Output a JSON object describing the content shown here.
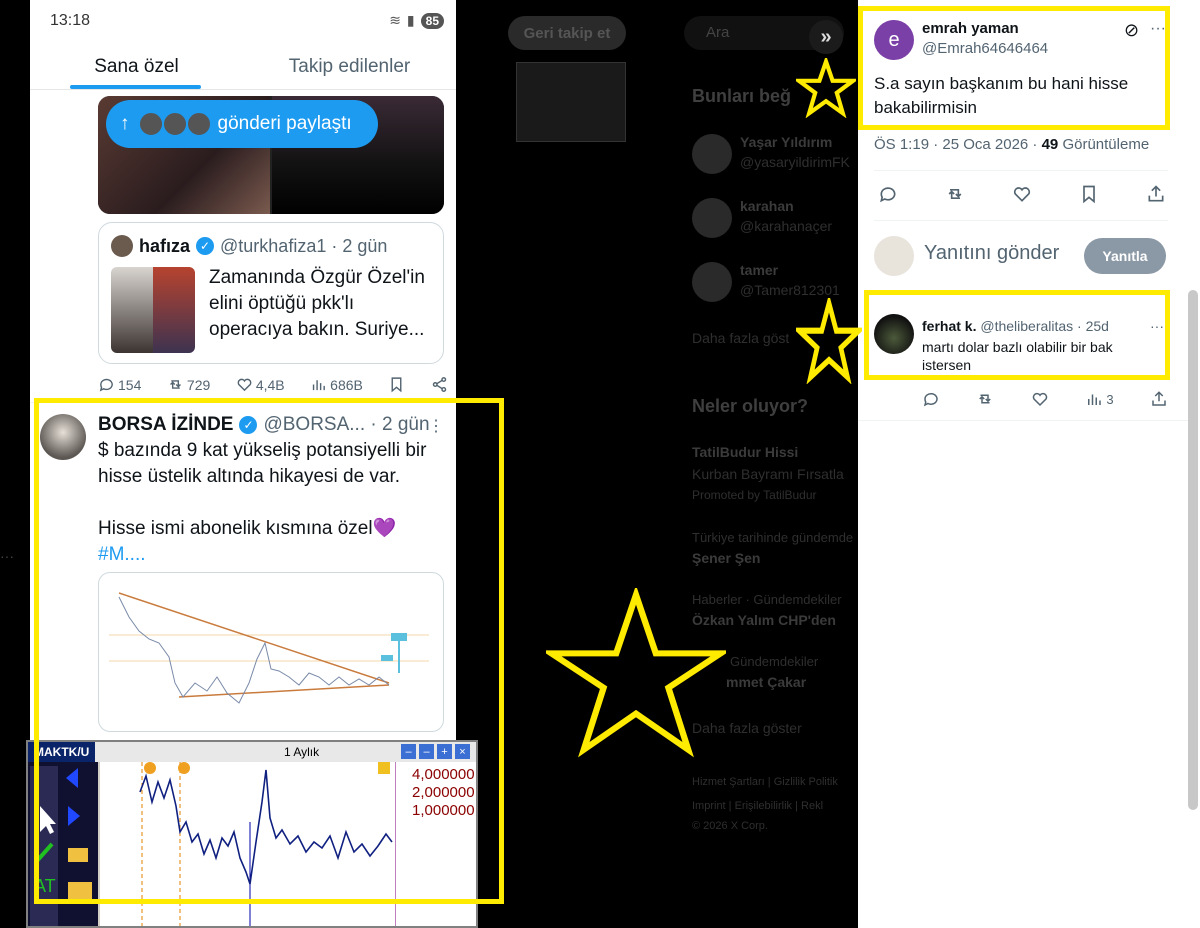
{
  "phone": {
    "time": "13:18",
    "battery": "85",
    "tabs": [
      "Sana özel",
      "Takip edilenler"
    ],
    "share_pill": "gönderi paylaştı",
    "quote": {
      "name": "hafıza",
      "handle": "@turkhafiza1 · 2 gün",
      "text": "Zamanında Özgür Özel'in elini öptüğü pkk'lı operacıya bakın. Suriye..."
    },
    "actions": {
      "replies": "154",
      "reposts": "729",
      "likes": "4,4B",
      "views": "686B"
    },
    "tweet": {
      "name": "BORSA İZİNDE",
      "handle": "@BORSA... · 2 gün",
      "line1": "$ bazında 9 kat yükseliş potansiyelli bir hisse üstelik altında hikayesi de var.",
      "line2": "Hisse ismi abonelik kısmına özel💜",
      "hashtag": "#M...."
    },
    "inset": {
      "ticker": "MAKTK/U",
      "period": "1 Aylık",
      "axis": [
        "4,000000",
        "2,000000",
        "1,000000"
      ]
    }
  },
  "background": {
    "follow_btn": "Geri takip et",
    "search": "Ara",
    "who_to_follow": "Bunları beğ",
    "follow_names": [
      "Yaşar Yıldırım",
      "karahan",
      "tamer"
    ],
    "follow_handles": [
      "@yasaryildirimFK",
      "@karahanaçer",
      "@Tamer812301"
    ],
    "show_more": "Daha fazla göst",
    "whats_happening": "Neler oluyor?",
    "trend1_title": "TatilBudur Hissi",
    "trend1_sub": "Kurban Bayramı Fırsatla",
    "trend1_promo": "Promoted by TatilBudur",
    "trend2_ctx": "Türkiye tarihinde gündemde",
    "trend2_title": "Şener Şen",
    "trend3_ctx": "Haberler · Gündemdekiler",
    "trend3_title": "Özkan Yalım CHP'den",
    "trend4_ctx": "Gündemdekiler",
    "trend4_title": "mmet Çakar",
    "show_more2": "Daha fazla göster",
    "footer1": "Hizmet Şartları  |  Gizlilik Politik",
    "footer2": "Imprint  |  Erişilebilirlik  |  Rekl",
    "footer3": "© 2026 X Corp."
  },
  "right": {
    "post1": {
      "avatar_letter": "e",
      "name": "emrah yaman",
      "handle": "@Emrah64646464",
      "text": "S.a sayın başkanım bu hani hisse bakabilirmisin",
      "meta_time": "ÖS 1:19 · 25 Oca 2026 · ",
      "meta_views": "49",
      "meta_views_label": " Görüntüleme"
    },
    "reply_placeholder": "Yanıtını gönder",
    "reply_button": "Yanıtla",
    "post2": {
      "name": "ferhat k.",
      "handle": "@theliberalitas · 25d",
      "text": "martı dolar bazlı olabilir bir bak istersen",
      "views": "3"
    }
  },
  "colors": {
    "highlight": "#ffeb00",
    "accent": "#1d9bf0"
  }
}
